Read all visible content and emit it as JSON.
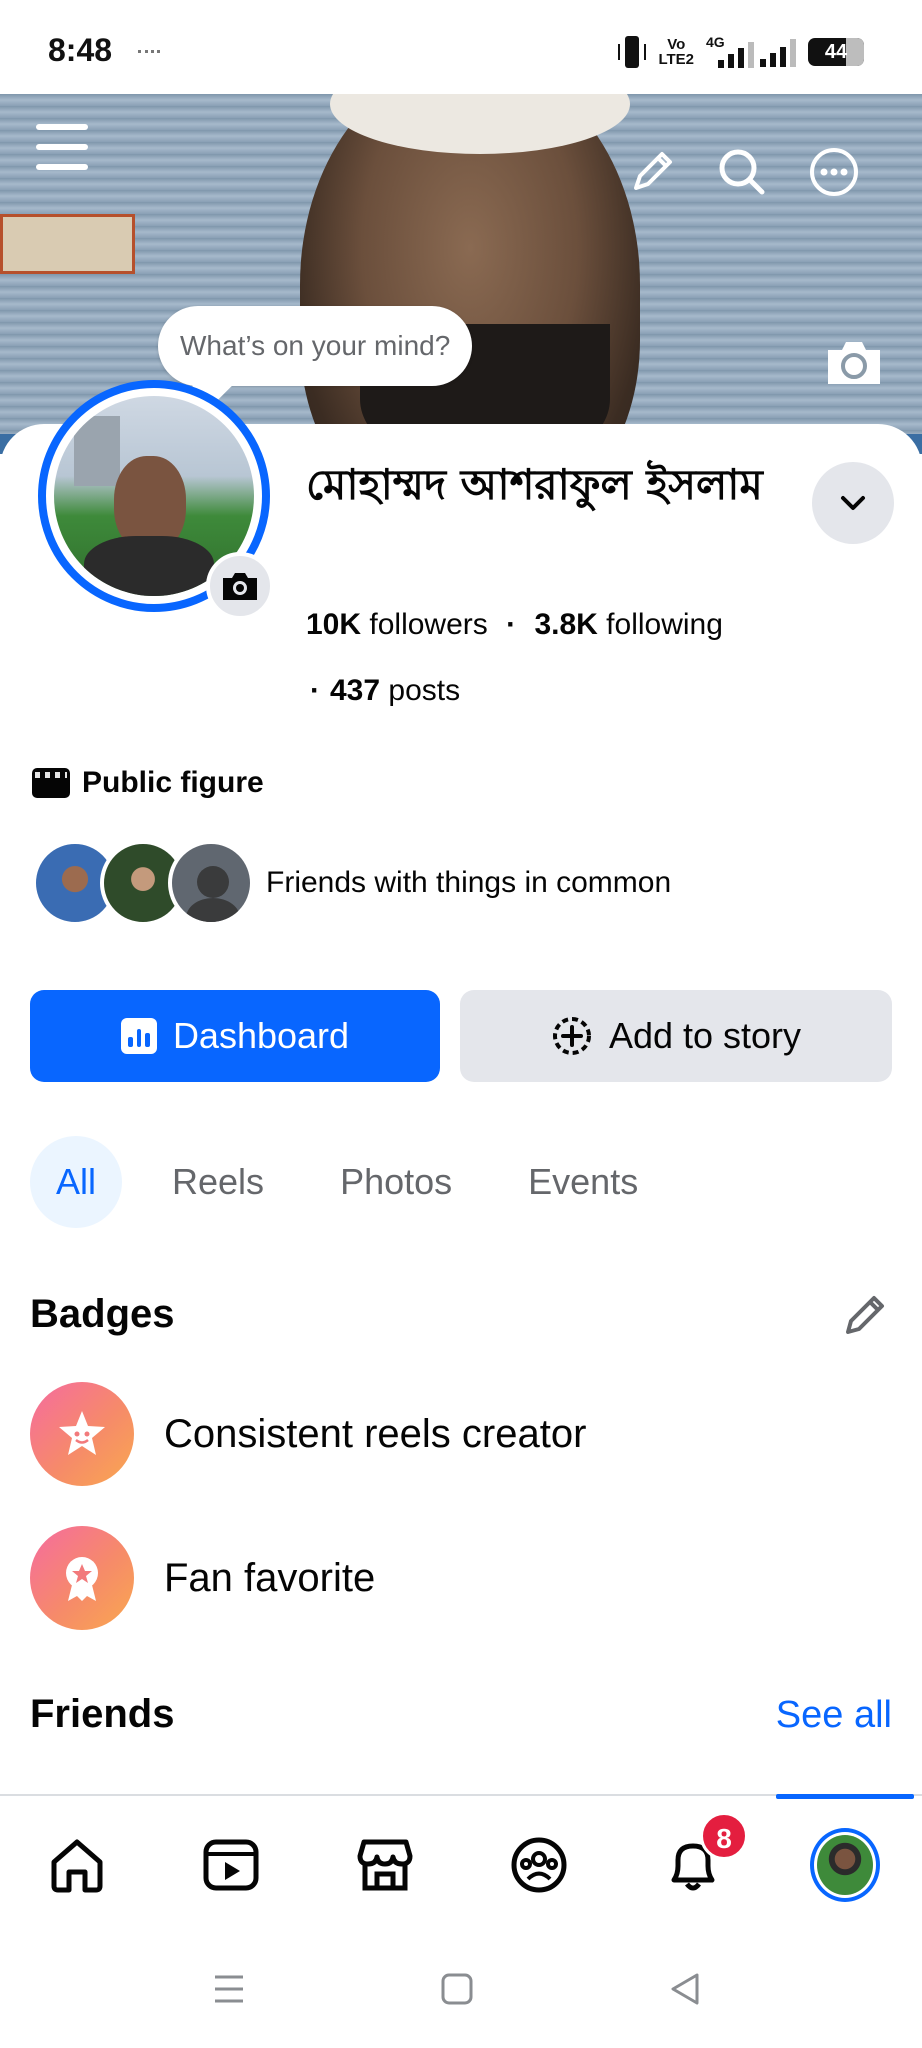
{
  "status_bar": {
    "time": "8:48",
    "volte_top": "Vo",
    "volte_bottom": "LTE2",
    "network": "4G",
    "battery": "44"
  },
  "cover": {
    "whats_on_mind": "What’s on your mind?"
  },
  "profile": {
    "name": "মোহাম্মদ আশরাফুল ইসলাম",
    "followers_count": "10K",
    "followers_label": "followers",
    "following_count": "3.8K",
    "following_label": "following",
    "posts_count": "437",
    "posts_label": "posts",
    "category": "Public figure",
    "mutuals_text": "Friends with things in common"
  },
  "actions": {
    "dashboard_label": "Dashboard",
    "add_story_label": "Add to story"
  },
  "tabs": [
    {
      "label": "All",
      "active": true
    },
    {
      "label": "Reels",
      "active": false
    },
    {
      "label": "Photos",
      "active": false
    },
    {
      "label": "Events",
      "active": false
    }
  ],
  "badges": {
    "title": "Badges",
    "items": [
      {
        "label": "Consistent reels creator",
        "icon": "star-face-icon"
      },
      {
        "label": "Fan favorite",
        "icon": "ribbon-star-icon"
      }
    ]
  },
  "friends": {
    "title": "Friends",
    "see_all": "See all"
  },
  "bottom_nav": {
    "items": [
      "home-icon",
      "video-icon",
      "marketplace-icon",
      "groups-icon",
      "notifications-icon",
      "profile-avatar"
    ],
    "notifications_badge": "8",
    "active": "profile-avatar"
  },
  "colors": {
    "accent": "#0866ff",
    "badge_red": "#e41e3f",
    "secondary_bg": "#e4e6eb",
    "tab_active_bg": "#ebf5ff"
  }
}
